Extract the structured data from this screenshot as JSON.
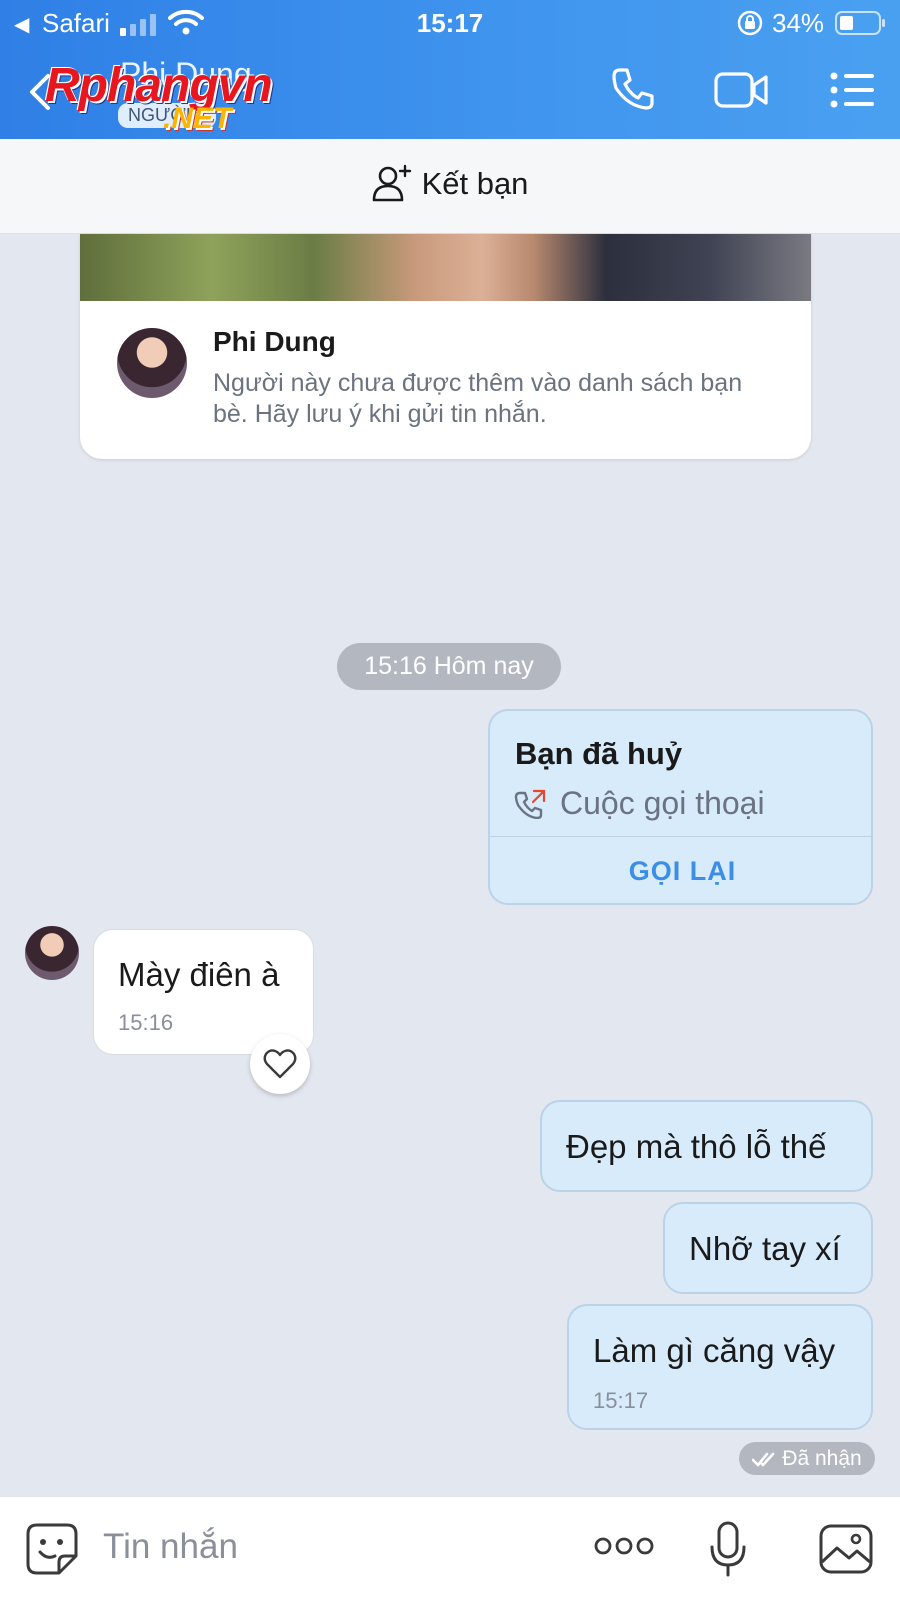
{
  "status_bar": {
    "back_glyph": "◀",
    "app": "Safari",
    "time": "15:17",
    "battery": "34%",
    "icons": [
      "signal-icon",
      "wifi-icon",
      "rotation-lock-icon",
      "battery-icon"
    ]
  },
  "nav": {
    "title": "Phi Dung",
    "subtitle": "NGƯỜI L",
    "icons": [
      "back-icon",
      "phone-icon",
      "video-call-icon",
      "menu-list-icon"
    ]
  },
  "watermark": {
    "main": "Rphangvn",
    "suffix": ".NET"
  },
  "add_friend": {
    "label": "Kết bạn",
    "icon": "add-friend-icon"
  },
  "profile_card": {
    "name": "Phi Dung",
    "note": "Người này chưa được thêm vào danh sách bạn bè. Hãy lưu ý khi gửi tin nhắn."
  },
  "time_divider": "15:16 Hôm nay",
  "call_card": {
    "title": "Bạn đã huỷ",
    "type": "Cuộc gọi thoại",
    "action": "GỌI LẠI",
    "icon": "outgoing-call-icon"
  },
  "messages": [
    {
      "direction": "in",
      "text": "Mày điên à",
      "time": "15:16"
    },
    {
      "direction": "out",
      "text": "Đẹp mà thô lỗ thế"
    },
    {
      "direction": "out",
      "text": "Nhỡ tay xí"
    },
    {
      "direction": "out",
      "text": "Làm gì căng vậy",
      "time": "15:17"
    }
  ],
  "delivery_status": "Đã nhận",
  "input": {
    "placeholder": "Tin nhắn",
    "icons": [
      "sticker-icon",
      "more-dots-icon",
      "microphone-icon",
      "image-icon"
    ]
  },
  "colors": {
    "header_blue": "#3a8cec",
    "bubble_out": "#d7ebfb",
    "chat_bg": "#e3e7ef",
    "accent": "#3b8ee6"
  }
}
